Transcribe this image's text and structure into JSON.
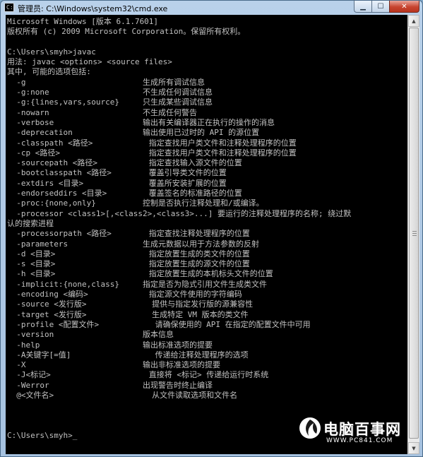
{
  "window": {
    "title": "管理员: C:\\Windows\\system32\\cmd.exe",
    "icon": "cmd-icon",
    "icon_text": "C:\\",
    "controls": {
      "minimize_glyph": "▁",
      "maximize_glyph": "☐",
      "close_glyph": "✕"
    }
  },
  "console": {
    "lines": [
      "Microsoft Windows [版本 6.1.7601]",
      "版权所有 (c) 2009 Microsoft Corporation。保留所有权利。",
      "",
      "C:\\Users\\smyh>javac",
      "用法: javac <options> <source files>",
      "其中, 可能的选项包括:",
      "  -g                         生成所有调试信息",
      "  -g:none                    不生成任何调试信息",
      "  -g:{lines,vars,source}     只生成某些调试信息",
      "  -nowarn                    不生成任何警告",
      "  -verbose                   输出有关编译器正在执行的操作的消息",
      "  -deprecation               输出使用已过时的 API 的源位置",
      "  -classpath <路径>            指定查找用户类文件和注释处理程序的位置",
      "  -cp <路径>                   指定查找用户类文件和注释处理程序的位置",
      "  -sourcepath <路径>           指定查找输入源文件的位置",
      "  -bootclasspath <路径>        覆盖引导类文件的位置",
      "  -extdirs <目录>              覆盖所安装扩展的位置",
      "  -endorseddirs <目录>         覆盖签名的标准路径的位置",
      "  -proc:{none,only}          控制是否执行注释处理和/或编译。",
      "  -processor <class1>[,<class2>,<class3>...] 要运行的注释处理程序的名称; 绕过默",
      "认的搜索进程",
      "  -processorpath <路径>        指定查找注释处理程序的位置",
      "  -parameters                生成元数据以用于方法参数的反射",
      "  -d <目录>                    指定放置生成的类文件的位置",
      "  -s <目录>                    指定放置生成的源文件的位置",
      "  -h <目录>                    指定放置生成的本机标头文件的位置",
      "  -implicit:{none,class}     指定是否为隐式引用文件生成类文件",
      "  -encoding <编码>             指定源文件使用的字符编码",
      "  -source <发行版>              提供与指定发行版的源兼容性",
      "  -target <发行版>              生成特定 VM 版本的类文件",
      "  -profile <配置文件>            请确保使用的 API 在指定的配置文件中可用",
      "  -version                   版本信息",
      "  -help                      输出标准选项的提要",
      "  -A关键字[=值]                  传递给注释处理程序的选项",
      "  -X                         输出非标准选项的提要",
      "  -J<标记>                     直接将 <标记> 传递给运行时系统",
      "  -Werror                    出现警告时终止编译",
      "  @<文件名>                     从文件读取选项和文件名",
      "",
      "",
      "",
      "C:\\Users\\smyh>"
    ],
    "cursor": "_",
    "text_color": "#c0c0c0",
    "background": "#000000"
  },
  "watermark": {
    "title": "电脑百事网",
    "url": "WWW.PC841.COM",
    "icon": "pc841-logo-icon"
  }
}
